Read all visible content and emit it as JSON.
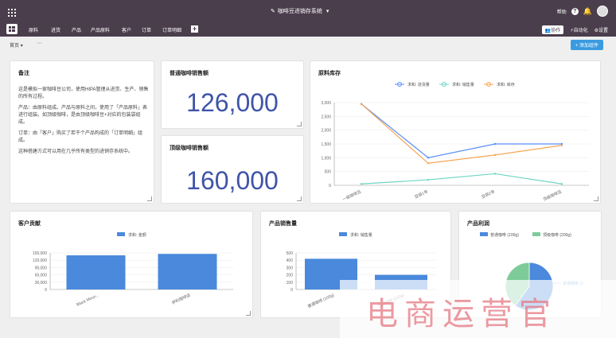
{
  "app": {
    "title": "咖啡豆进销存系统",
    "help_label": "帮助"
  },
  "nav": {
    "items": [
      "原料",
      "进货",
      "产品",
      "产品原料",
      "客户",
      "订单",
      "订单明细"
    ],
    "collab_label": "协作",
    "automation_label": "自动化",
    "settings_label": "设置"
  },
  "subbar": {
    "page_label": "首页",
    "more_label": "···",
    "add_widget_label": "+ 添加组件"
  },
  "notes": {
    "title": "备注",
    "paragraphs": [
      "这是模拟一家咖啡豆公司，使用HIPA管理从进货、生产、销售的所有过程。",
      "产品：由原料组成。产品与原料之间，使用了「产品原料」表进行组装。如顶级咖啡，是由顶级咖啡豆+对应的包装袋组成。",
      "订单：由「客户」购买了若干个产品构成的「订单明细」组成。",
      "这种搭建方式可以用在几乎所有类型的进销存系统中。"
    ]
  },
  "kpi_regular": {
    "title": "普通咖啡销售额",
    "value": "126,000"
  },
  "kpi_premium": {
    "title": "顶级咖啡销售额",
    "value": "160,000"
  },
  "inventory_card_title": "原料库存",
  "customer_card_title": "客户贡献",
  "product_sales_card_title": "产品销售量",
  "profit_card_title": "产品利润",
  "chart_data": [
    {
      "type": "line",
      "title": "原料库存",
      "categories": [
        "一级咖啡豆",
        "豆袋1号",
        "豆袋2号",
        "顶级咖啡豆"
      ],
      "series": [
        {
          "name": "求和: 进货量",
          "color": "#5b8ff9",
          "values": [
            2950,
            1000,
            1500,
            1500
          ]
        },
        {
          "name": "求和: 销售量",
          "color": "#6dd5c4",
          "values": [
            50,
            200,
            420,
            50
          ]
        },
        {
          "name": "求和: 库存",
          "color": "#f5a653",
          "values": [
            2950,
            800,
            1100,
            1450
          ]
        }
      ],
      "yticks": [
        "0",
        "500",
        "1,000",
        "1,500",
        "2,000",
        "2,500",
        "3,000"
      ],
      "ylim": [
        0,
        3000
      ]
    },
    {
      "type": "bar",
      "title": "客户贡献",
      "categories": [
        "Black Moun...",
        "伊利咖啡店"
      ],
      "series": [
        {
          "name": "求和: 金额",
          "color": "#4a89dc",
          "values": [
            140000,
            146000
          ]
        }
      ],
      "yticks": [
        "0",
        "30,000",
        "60,000",
        "90,000",
        "120,000",
        "150,000"
      ],
      "ylim": [
        0,
        150000
      ]
    },
    {
      "type": "bar",
      "title": "产品销售量",
      "categories": [
        "普通咖啡 (100g)",
        "顶级咖啡 (200g)"
      ],
      "series": [
        {
          "name": "求和: 销售量",
          "color": "#4a89dc",
          "values": [
            420,
            200
          ]
        }
      ],
      "yticks": [
        "0",
        "100",
        "200",
        "300",
        "400",
        "500"
      ],
      "ylim": [
        0,
        500
      ]
    },
    {
      "type": "pie",
      "title": "产品利润",
      "series": [
        {
          "name": "普通咖啡 (100g)",
          "color": "#4a89dc",
          "value": 60
        },
        {
          "name": "顶级咖啡 (200g)",
          "color": "#7ecb9a",
          "value": 40
        }
      ],
      "slice_label": "普通咖啡 (1"
    }
  ],
  "watermark": {
    "text": "电商运营官"
  }
}
